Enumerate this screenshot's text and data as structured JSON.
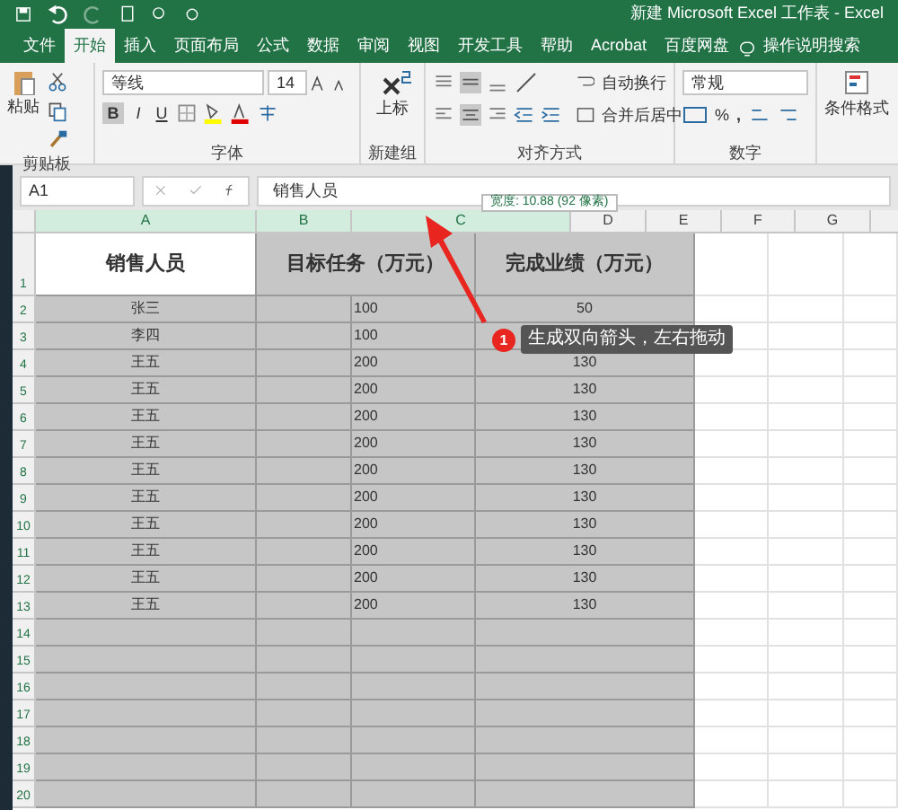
{
  "title_bar": {
    "title": "新建 Microsoft Excel 工作表 - Excel"
  },
  "tabs": [
    {
      "label": "文件",
      "selected": false
    },
    {
      "label": "开始",
      "selected": true
    },
    {
      "label": "插入",
      "selected": false
    },
    {
      "label": "页面布局",
      "selected": false
    },
    {
      "label": "公式",
      "selected": false
    },
    {
      "label": "数据",
      "selected": false
    },
    {
      "label": "审阅",
      "selected": false
    },
    {
      "label": "视图",
      "selected": false
    },
    {
      "label": "开发工具",
      "selected": false
    },
    {
      "label": "帮助",
      "selected": false
    },
    {
      "label": "Acrobat",
      "selected": false
    },
    {
      "label": "百度网盘",
      "selected": false
    }
  ],
  "tell_me": "操作说明搜索",
  "ribbon": {
    "clipboard": {
      "paste": "粘贴",
      "label": "剪贴板"
    },
    "font": {
      "name": "等线",
      "size": "14",
      "label": "字体",
      "bold": "B",
      "italic": "I",
      "underline": "U"
    },
    "new_group": {
      "button": "上标",
      "label": "新建组"
    },
    "alignment": {
      "wrap": "自动换行",
      "merge": "合并后居中",
      "label": "对齐方式"
    },
    "number": {
      "format": "常规",
      "percent": "%",
      "comma": ",",
      "label": "数字"
    },
    "styles": {
      "button": "条件格式"
    }
  },
  "name_box": "A1",
  "formula": "销售人员",
  "tooltip": "宽度: 10.88 (92 像素)",
  "columns": [
    {
      "label": "A",
      "selected": true
    },
    {
      "label": "B",
      "selected": true
    },
    {
      "label": "C",
      "selected": true
    },
    {
      "label": "D",
      "selected": false
    },
    {
      "label": "E",
      "selected": false
    },
    {
      "label": "F",
      "selected": false
    },
    {
      "label": "G",
      "selected": false
    }
  ],
  "rows": [
    {
      "number": "1",
      "name": "销售人员",
      "target": "目标任务（万元）",
      "actual": "完成业绩（万元）"
    },
    {
      "number": "2",
      "name": "张三",
      "target": "100",
      "actual": "50"
    },
    {
      "number": "3",
      "name": "李四",
      "target": "100"
    },
    {
      "number": "4",
      "name": "王五",
      "target": "200",
      "actual": "130"
    },
    {
      "number": "5",
      "name": "王五",
      "target": "200",
      "actual": "130"
    },
    {
      "number": "6",
      "name": "王五",
      "target": "200",
      "actual": "130"
    },
    {
      "number": "7",
      "name": "王五",
      "target": "200",
      "actual": "130"
    },
    {
      "number": "8",
      "name": "王五",
      "target": "200",
      "actual": "130"
    },
    {
      "number": "9",
      "name": "王五",
      "target": "200",
      "actual": "130"
    },
    {
      "number": "10",
      "name": "王五",
      "target": "200",
      "actual": "130"
    },
    {
      "number": "11",
      "name": "王五",
      "target": "200",
      "actual": "130"
    },
    {
      "number": "12",
      "name": "王五",
      "target": "200",
      "actual": "130"
    },
    {
      "number": "13",
      "name": "王五",
      "target": "200",
      "actual": "130"
    },
    {
      "number": "14"
    },
    {
      "number": "15"
    },
    {
      "number": "16"
    },
    {
      "number": "17"
    },
    {
      "number": "18"
    },
    {
      "number": "19"
    },
    {
      "number": "20"
    }
  ],
  "callout": {
    "badge": "1",
    "text": "生成双向箭头，左右拖动"
  }
}
